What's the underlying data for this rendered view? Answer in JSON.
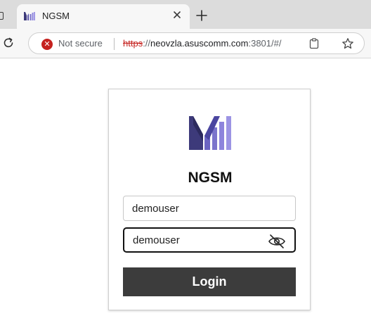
{
  "browser": {
    "tab": {
      "title": "NGSM"
    },
    "address": {
      "security_label": "Not secure",
      "url_scheme": "https",
      "url_rest_prefix": "://",
      "url_host": "neovzla.asuscomm.com",
      "url_path": ":3801/#/"
    }
  },
  "login": {
    "brand": "NGSM",
    "username_value": "demouser",
    "password_value": "demouser",
    "button_label": "Login"
  },
  "colors": {
    "logo_purple_dark": "#3d3a7a",
    "logo_purple_light": "#8d84dc",
    "button_bg": "#3c3c3c",
    "insecure_red": "#c5221f"
  },
  "icons": [
    "favicon-icon",
    "close-icon",
    "plus-icon",
    "reload-icon",
    "not-secure-icon",
    "clipboard-icon",
    "star-icon",
    "eye-off-icon",
    "ngsm-logo-icon"
  ]
}
